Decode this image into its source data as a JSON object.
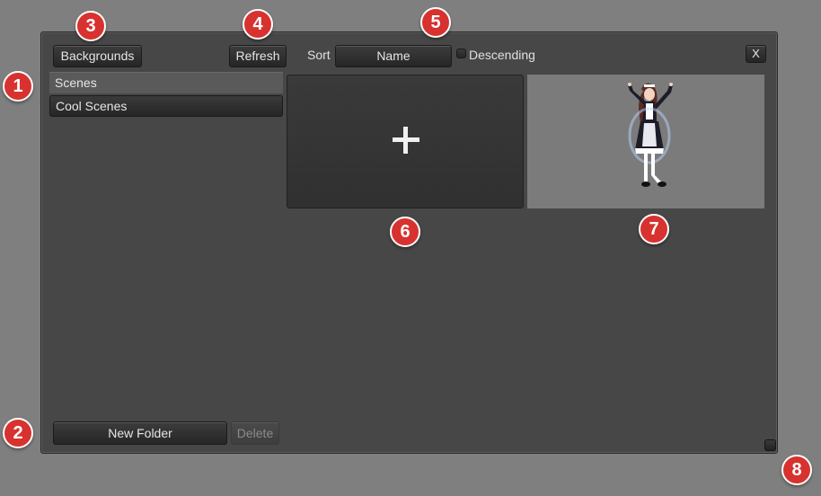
{
  "toolbar": {
    "backgrounds_label": "Backgrounds",
    "refresh_label": "Refresh",
    "sort_label": "Sort",
    "sort_value": "Name",
    "descending_label": "Descending",
    "close_label": "X"
  },
  "folders": [
    {
      "label": "Scenes",
      "selected": true
    },
    {
      "label": "Cool Scenes",
      "selected": false
    }
  ],
  "footer": {
    "new_folder_label": "New Folder",
    "delete_label": "Delete"
  },
  "tiles": {
    "add_symbol": "+",
    "preview_subject": "maid-character"
  },
  "badges": [
    "1",
    "2",
    "3",
    "4",
    "5",
    "6",
    "7",
    "8"
  ],
  "colors": {
    "background": "#7f7f7f",
    "window": "#474747",
    "badge": "#d7322f"
  }
}
